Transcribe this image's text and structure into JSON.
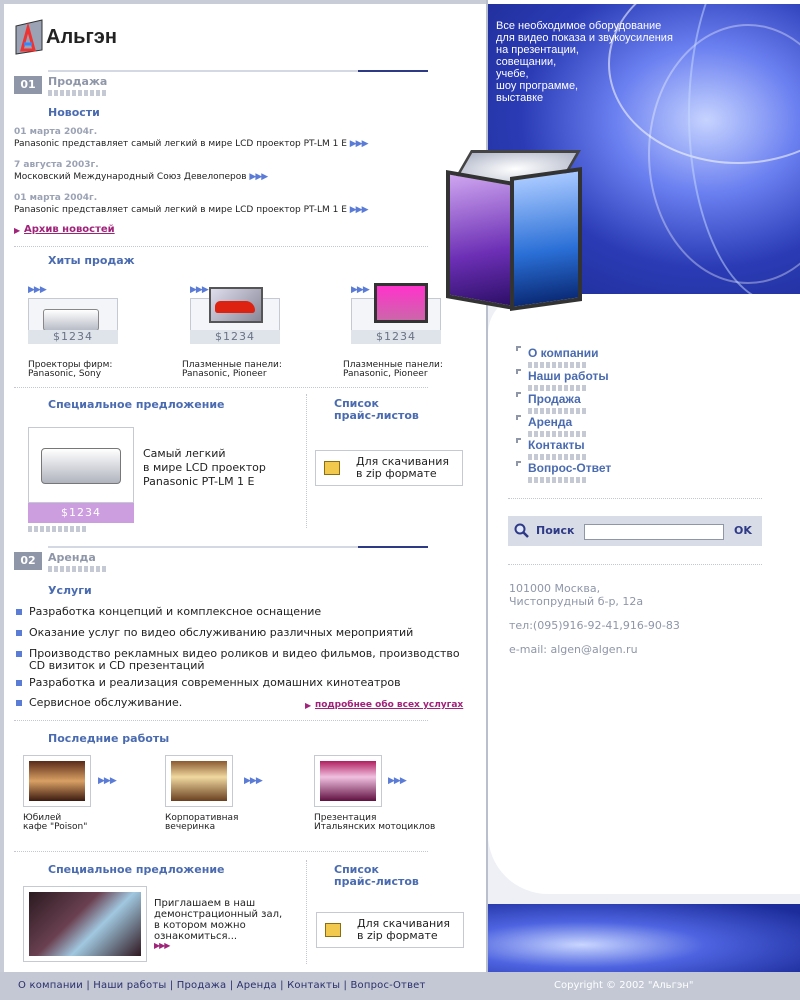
{
  "brand": {
    "name": "Альгэн"
  },
  "hero": {
    "lines": [
      "Все необходимое оборудование",
      "для видео показа и звукоусиления",
      "на презентации,",
      "совещании,",
      "учебе,",
      "шоу программе,",
      "выставке"
    ]
  },
  "section1": {
    "num": "01",
    "title": "Продажа"
  },
  "news": {
    "heading": "Новости",
    "items": [
      {
        "date": "01 марта 2004г.",
        "text": "Panasonic представляет самый легкий в мире LCD проектор PT-LM 1 E"
      },
      {
        "date": "7 августа 2003г.",
        "text": "Московский Международный Союз Девелоперов"
      },
      {
        "date": "01 марта 2004г.",
        "text": "Panasonic представляет  самый легкий в мире LCD проектор  PT-LM 1 E"
      }
    ],
    "archive": "Архив новостей"
  },
  "hits": {
    "heading": "Хиты продаж",
    "items": [
      {
        "price": "$1234",
        "caption1": "Проекторы фирм:",
        "caption2": "Panasonic, Sony"
      },
      {
        "price": "$1234",
        "caption1": "Плазменные панели:",
        "caption2": "Panasonic, Pioneer"
      },
      {
        "price": "$1234",
        "caption1": "Плазменные панели:",
        "caption2": "Panasonic, Pioneer"
      }
    ]
  },
  "special1": {
    "heading": "Специальное предложение",
    "text": [
      "Самый легкий",
      "в мире LCD проектор",
      "Panasonic  PT-LM 1 E"
    ],
    "price": "$1234"
  },
  "pricelist1": {
    "heading": [
      "Список",
      "прайс-листов"
    ],
    "download": [
      "Для скачивания",
      "в zip формате"
    ]
  },
  "section2": {
    "num": "02",
    "title": "Аренда"
  },
  "services": {
    "heading": "Услуги",
    "items": [
      "Разработка концепций и комплексное оснащение",
      "Оказание услуг по видео обслуживанию различных мероприятий",
      "Производство рекламных видео роликов и видео фильмов, производство",
      "Разработка и реализация современных домашних кинотеатров",
      "Сервисное обслуживание."
    ],
    "item3_line2": "CD визиток и CD презентаций",
    "more": "подробнее обо всех услугах"
  },
  "works": {
    "heading": "Последние работы",
    "items": [
      {
        "line1": "Юбилей",
        "line2": "кафе \"Poison\""
      },
      {
        "line1": "Корпоративная",
        "line2": "вечеринка"
      },
      {
        "line1": "Презентация",
        "line2": "Итальянских мотоциклов"
      }
    ]
  },
  "special2": {
    "heading": "Специальное предложение",
    "text": [
      "Приглашаем в наш",
      "демонстрационный зал,",
      "в котором можно",
      "ознакомиться..."
    ]
  },
  "pricelist2": {
    "heading": [
      "Список",
      "прайс-листов"
    ],
    "download": [
      "Для скачивания",
      "в zip формате"
    ]
  },
  "menu": {
    "items": [
      "О компании",
      "Наши работы",
      "Продажа",
      "Аренда",
      "Контакты",
      "Вопрос-Ответ"
    ]
  },
  "search": {
    "label": "Поиск",
    "button": "OK",
    "value": ""
  },
  "contact": {
    "addr1": "101000 Москва,",
    "addr2": "Чистопрудный б-р, 12а",
    "phone": "тел:(095)916-92-41,916-90-83",
    "email": "e-mail: algen@algen.ru"
  },
  "footer": {
    "nav": "О компании | Наши работы | Продажа | Аренда | Контакты | Вопрос-Ответ",
    "copyright": "Copyright © 2002 \"Альгэн\""
  },
  "colors": {
    "accent": "#4a6bb0",
    "link": "#a0237a",
    "badge": "#8e96a8",
    "dark": "#2f3a86"
  }
}
